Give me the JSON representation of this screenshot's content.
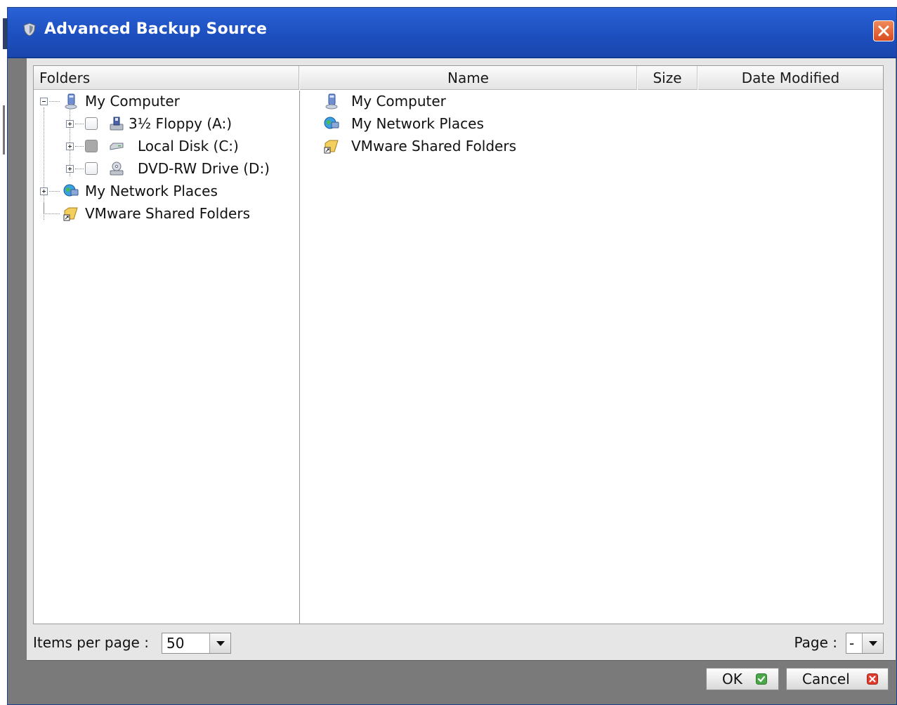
{
  "dialog": {
    "title": "Advanced Backup Source"
  },
  "columns": {
    "folders": "Folders",
    "name": "Name",
    "size": "Size",
    "date_modified": "Date Modified"
  },
  "tree": {
    "my_computer": "My Computer",
    "floppy": "3½ Floppy (A:)",
    "local_disk": "Local Disk (C:)",
    "dvd": "DVD-RW Drive (D:)",
    "network": "My Network Places",
    "vmware": "VMware Shared Folders"
  },
  "list": {
    "items": [
      "My Computer",
      "My Network Places",
      "VMware Shared Folders"
    ]
  },
  "footer": {
    "items_per_page_label": "Items per page :",
    "items_per_page_value": "50",
    "page_label": "Page :",
    "page_value": "-"
  },
  "buttons": {
    "ok": "OK",
    "cancel": "Cancel"
  },
  "colors": {
    "titlebar": "#1d4fbf",
    "close": "#d84c21",
    "ok_check": "#4aa84a",
    "cancel_x": "#e23b2e"
  }
}
